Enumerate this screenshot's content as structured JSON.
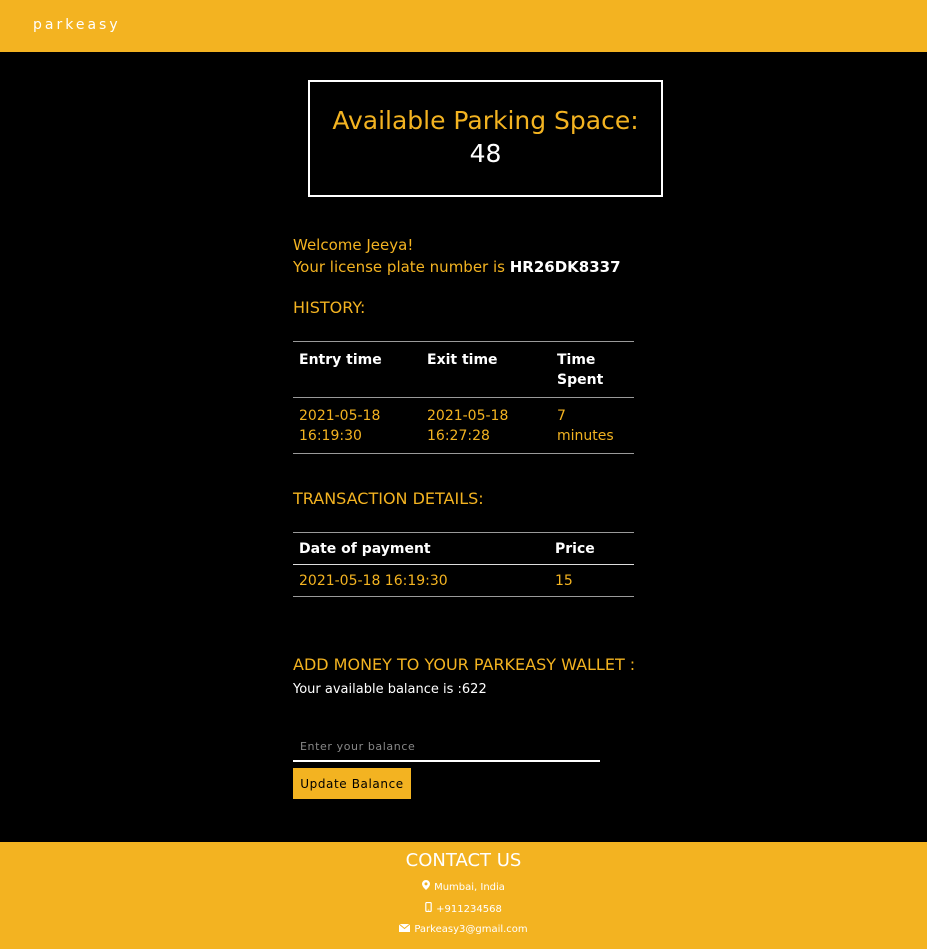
{
  "header": {
    "brand": "parkeasy"
  },
  "availability": {
    "label": "Available Parking Space:",
    "count": "48"
  },
  "welcome": {
    "greeting": "Welcome Jeeya!",
    "plate_prefix": "Your license plate number is ",
    "plate": "HR26DK8337"
  },
  "history": {
    "title": "HISTORY:",
    "columns": [
      "Entry time",
      "Exit time",
      "Time Spent"
    ],
    "rows": [
      {
        "entry_date": "2021-05-18",
        "entry_time": "16:19:30",
        "exit_date": "2021-05-18",
        "exit_time": "16:27:28",
        "spent_value": "7",
        "spent_unit": "minutes"
      }
    ]
  },
  "transactions": {
    "title": "TRANSACTION DETAILS:",
    "columns": [
      "Date of payment",
      "Price"
    ],
    "rows": [
      {
        "date": "2021-05-18 16:19:30",
        "price": "15"
      }
    ]
  },
  "wallet": {
    "title": "ADD MONEY TO YOUR PARKEASY WALLET :",
    "balance_label": "Your available balance is :",
    "balance": "622",
    "input_placeholder": "Enter your balance",
    "button_label": "Update Balance"
  },
  "footer": {
    "title": "CONTACT US",
    "location": "Mumbai, India",
    "phone": "+911234568",
    "email": "Parkeasy3@gmail.com"
  },
  "colors": {
    "accent": "#f3b321",
    "background": "#000000",
    "text": "#ffffff"
  },
  "icons": {
    "location": "map-pin-icon",
    "phone": "mobile-phone-icon",
    "email": "envelope-icon"
  }
}
